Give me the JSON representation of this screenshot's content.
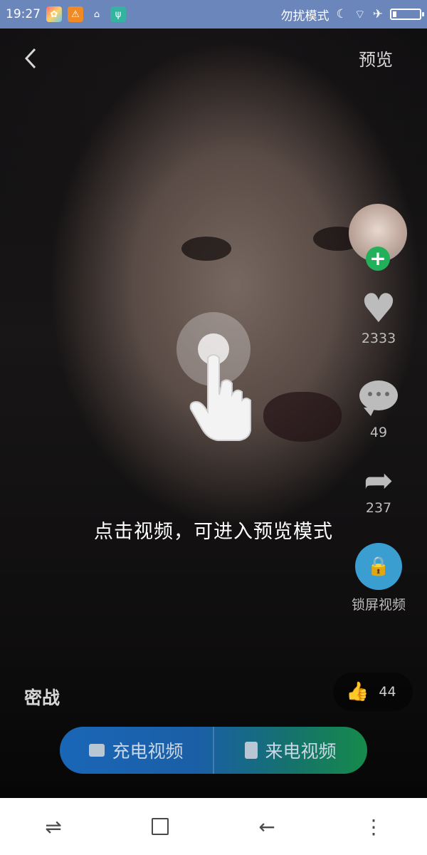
{
  "status_bar": {
    "time": "19:27",
    "dnd_text": "勿扰模式",
    "icons": [
      "moon-icon",
      "wifi-icon",
      "airplane-icon",
      "battery-icon"
    ]
  },
  "header": {
    "preview_label": "预览"
  },
  "side_actions": {
    "likes": "2333",
    "comments": "49",
    "shares": "237",
    "lock_label": "锁屏视频"
  },
  "guide": {
    "text": "点击视频，可进入预览模式"
  },
  "video": {
    "title": "密战",
    "like_count": "44"
  },
  "cta": {
    "charge_label": "充电视频",
    "call_label": "来电视频"
  },
  "colors": {
    "status_bar": "#6b86ba",
    "follow": "#22b05b",
    "lock": "#3b9ed1",
    "cta_left": "#1a66b7",
    "cta_right": "#168a4a"
  }
}
